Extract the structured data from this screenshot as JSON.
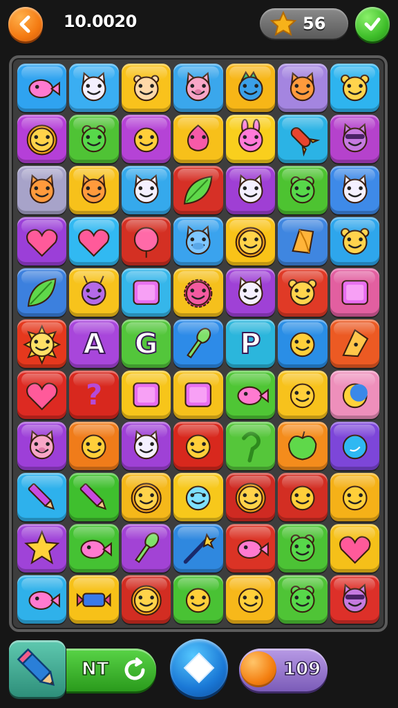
{
  "header": {
    "score": "10.0020",
    "stars": "56",
    "back_icon": "chevron-left-icon",
    "confirm_icon": "check-icon",
    "star_icon": "star-icon"
  },
  "board": {
    "rows": [
      [
        {
          "color": "#2fa3f0",
          "icon": "fish"
        },
        {
          "color": "#3aaef2",
          "icon": "cat"
        },
        {
          "color": "#f9c21c",
          "icon": "hamster"
        },
        {
          "color": "#3aa7ec",
          "icon": "pig"
        },
        {
          "color": "#f7b617",
          "icon": "dragon"
        },
        {
          "color": "#a485e0",
          "icon": "fox"
        },
        {
          "color": "#2eb4ef",
          "icon": "bear"
        }
      ],
      [
        {
          "color": "#b53fd8",
          "icon": "lion"
        },
        {
          "color": "#4fc335",
          "icon": "frog"
        },
        {
          "color": "#b543d6",
          "icon": "smiley"
        },
        {
          "color": "#f7c01a",
          "icon": "blob"
        },
        {
          "color": "#f9cf1d",
          "icon": "bunny"
        },
        {
          "color": "#2bb3e5",
          "icon": "rocket"
        },
        {
          "color": "#b542cc",
          "icon": "raccoon"
        }
      ],
      [
        {
          "color": "#a7a3c9",
          "icon": "fox"
        },
        {
          "color": "#f7c11b",
          "icon": "fox"
        },
        {
          "color": "#35a9ec",
          "icon": "cat"
        },
        {
          "color": "#d63026",
          "icon": "leaf"
        },
        {
          "color": "#9f3fd4",
          "icon": "cat"
        },
        {
          "color": "#4dc331",
          "icon": "frog"
        },
        {
          "color": "#3e8ae8",
          "icon": "cat"
        }
      ],
      [
        {
          "color": "#9b3fd8",
          "icon": "heart"
        },
        {
          "color": "#31b9f2",
          "icon": "heart"
        },
        {
          "color": "#d43023",
          "icon": "balloon"
        },
        {
          "color": "#3aa3ee",
          "icon": "hippo"
        },
        {
          "color": "#f9c318",
          "icon": "lion"
        },
        {
          "color": "#3f86e0",
          "icon": "gem"
        },
        {
          "color": "#2ea6ec",
          "icon": "bear"
        }
      ],
      [
        {
          "color": "#3c80de",
          "icon": "leaf"
        },
        {
          "color": "#f7c31c",
          "icon": "bug"
        },
        {
          "color": "#35b6ea",
          "icon": "box"
        },
        {
          "color": "#f5c01c",
          "icon": "urchin"
        },
        {
          "color": "#9f41d6",
          "icon": "cat"
        },
        {
          "color": "#e03a26",
          "icon": "bear"
        },
        {
          "color": "#e25fa0",
          "icon": "box"
        }
      ],
      [
        {
          "color": "#e5381d",
          "icon": "sun"
        },
        {
          "color": "#a846db",
          "icon": "letter",
          "letter": "A"
        },
        {
          "color": "#53c63b",
          "icon": "letter",
          "letter": "G"
        },
        {
          "color": "#2d8be8",
          "icon": "key"
        },
        {
          "color": "#2bb6dc",
          "icon": "letter",
          "letter": "P"
        },
        {
          "color": "#2a8ee6",
          "icon": "smiley"
        },
        {
          "color": "#ec5a23",
          "icon": "pixie"
        }
      ],
      [
        {
          "color": "#dd2a22",
          "icon": "heart"
        },
        {
          "color": "#d8281e",
          "icon": "question"
        },
        {
          "color": "#f7c51a",
          "icon": "box"
        },
        {
          "color": "#f6c11b",
          "icon": "box"
        },
        {
          "color": "#4fc635",
          "icon": "fish"
        },
        {
          "color": "#f7c21c",
          "icon": "smiley"
        },
        {
          "color": "#ee8fbb",
          "icon": "moon"
        }
      ],
      [
        {
          "color": "#9d3fd8",
          "icon": "pig"
        },
        {
          "color": "#f07c1a",
          "icon": "smiley"
        },
        {
          "color": "#9f41d6",
          "icon": "cat"
        },
        {
          "color": "#d8281d",
          "icon": "smiley"
        },
        {
          "color": "#55c63a",
          "icon": "hook"
        },
        {
          "color": "#f48c1c",
          "icon": "apple"
        },
        {
          "color": "#7d46d9",
          "icon": "orb"
        }
      ],
      [
        {
          "color": "#2eb1ec",
          "icon": "pencil"
        },
        {
          "color": "#3fbf2e",
          "icon": "pencil"
        },
        {
          "color": "#f5b81a",
          "icon": "lion"
        },
        {
          "color": "#f7c81b",
          "icon": "alien"
        },
        {
          "color": "#cf2a22",
          "icon": "lion"
        },
        {
          "color": "#d32e23",
          "icon": "smiley"
        },
        {
          "color": "#f5b118",
          "icon": "smiley"
        }
      ],
      [
        {
          "color": "#9f43d8",
          "icon": "star"
        },
        {
          "color": "#45c233",
          "icon": "fish"
        },
        {
          "color": "#a243d5",
          "icon": "key"
        },
        {
          "color": "#2f88df",
          "icon": "wand"
        },
        {
          "color": "#db3325",
          "icon": "fish"
        },
        {
          "color": "#4cc335",
          "icon": "frog"
        },
        {
          "color": "#f5c019",
          "icon": "heart"
        }
      ],
      [
        {
          "color": "#2fb1ea",
          "icon": "fish"
        },
        {
          "color": "#f7c118",
          "icon": "candy"
        },
        {
          "color": "#d22d22",
          "icon": "lion"
        },
        {
          "color": "#49c234",
          "icon": "smiley"
        },
        {
          "color": "#f7b81a",
          "icon": "smiley"
        },
        {
          "color": "#4fc436",
          "icon": "frog"
        },
        {
          "color": "#dd3029",
          "icon": "raccoon"
        }
      ]
    ]
  },
  "footer": {
    "hint_label": "NT",
    "coins": "109",
    "pencil_icon": "pencil-icon",
    "refresh_icon": "refresh-icon",
    "play_icon": "diamond-icon",
    "coin_icon": "coin-icon"
  }
}
